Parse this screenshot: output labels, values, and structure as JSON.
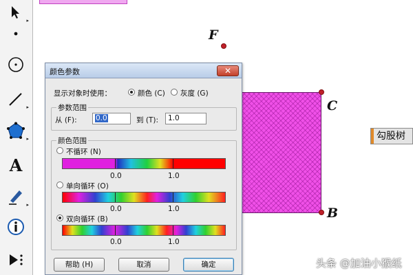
{
  "canvas": {
    "points": {
      "f": "F",
      "c": "C",
      "b": "B"
    },
    "side_button_label": "勾股树",
    "watermark": "头条 @加油小猴纸"
  },
  "toolbox": {
    "tools": [
      "arrow-select-icon",
      "point-icon",
      "compass-icon",
      "line-segment-icon",
      "polygon-icon",
      "text-icon",
      "marker-pen-icon",
      "info-icon",
      "custom-tool-icon"
    ],
    "text_tool_glyph": "A"
  },
  "dialog": {
    "title": "颜色参数",
    "close_glyph": "✕",
    "display_label": "显示对象时使用：",
    "color_option": "颜色 (C)",
    "gray_option": "灰度 (G)",
    "param_range": {
      "title": "参数范围",
      "from_label": "从 (F):",
      "from_value": "0.0",
      "to_label": "到 (T):",
      "to_value": "1.0"
    },
    "color_range": {
      "title": "颜色范围",
      "no_cycle": "不循环 (N)",
      "one_way": "单向循环 (O)",
      "two_way": "双向循环 (B)",
      "tick_start": "0.0",
      "tick_end": "1.0",
      "selected": "双向循环 (B)"
    },
    "buttons": {
      "help": "帮助 (H)",
      "cancel": "取消",
      "ok": "确定"
    }
  },
  "colors": {
    "square_fill": "#f050e8",
    "point_red": "#c0202a",
    "dialog_bg": "#eaeaea",
    "titlebar": "#c8d8ee",
    "close_red": "#c2402a"
  }
}
